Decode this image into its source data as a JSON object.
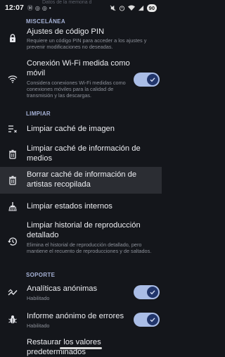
{
  "status_bar": {
    "time": "12:07",
    "apps": [
      "m-icon",
      "whatsapp-icon",
      "whatsapp-icon",
      "dot"
    ],
    "ghost_text": "Datos de la memoria del dispositivo",
    "battery": "90"
  },
  "sections": {
    "misc": "MISCELÁNEA",
    "clean": "LIMPIAR",
    "support": "SOPORTE"
  },
  "items": {
    "pin": {
      "title": "Ajustes de código PIN",
      "subtitle": "Requiere un código PIN para acceder a los ajustes y prevenir modificaciones no deseadas."
    },
    "wifi": {
      "title": "Conexión Wi-Fi medida como móvil",
      "subtitle": "Considera conexiones Wi-Fi medidas como conexiones móviles para la calidad de transmisión y las descargas.",
      "enabled": true
    },
    "image_cache": {
      "title": "Limpiar caché de imagen"
    },
    "media_cache": {
      "title": "Limpiar caché de información de medios"
    },
    "artist_cache": {
      "title": "Borrar caché de información de artistas recopilada"
    },
    "internal_states": {
      "title": "Limpiar estados internos"
    },
    "history": {
      "title": "Limpiar historial de reproducción detallado",
      "subtitle": "Elimina el historial de reproducción detallado, pero mantiene el recuento de reproducciones y de saltados."
    },
    "analytics": {
      "title": "Analíticas anónimas",
      "subtitle": "Habilitado",
      "enabled": true
    },
    "errors": {
      "title": "Informe anónimo de errores",
      "subtitle": "Habilitado",
      "enabled": true
    },
    "restore": {
      "title": "Restaurar los valores predeterminados"
    }
  },
  "colors": {
    "background": "#14161b",
    "section_header": "#a6b2d6",
    "toggle_track": "#aabde6",
    "toggle_knob": "#21356a",
    "highlight_row": "#2b2d33"
  }
}
